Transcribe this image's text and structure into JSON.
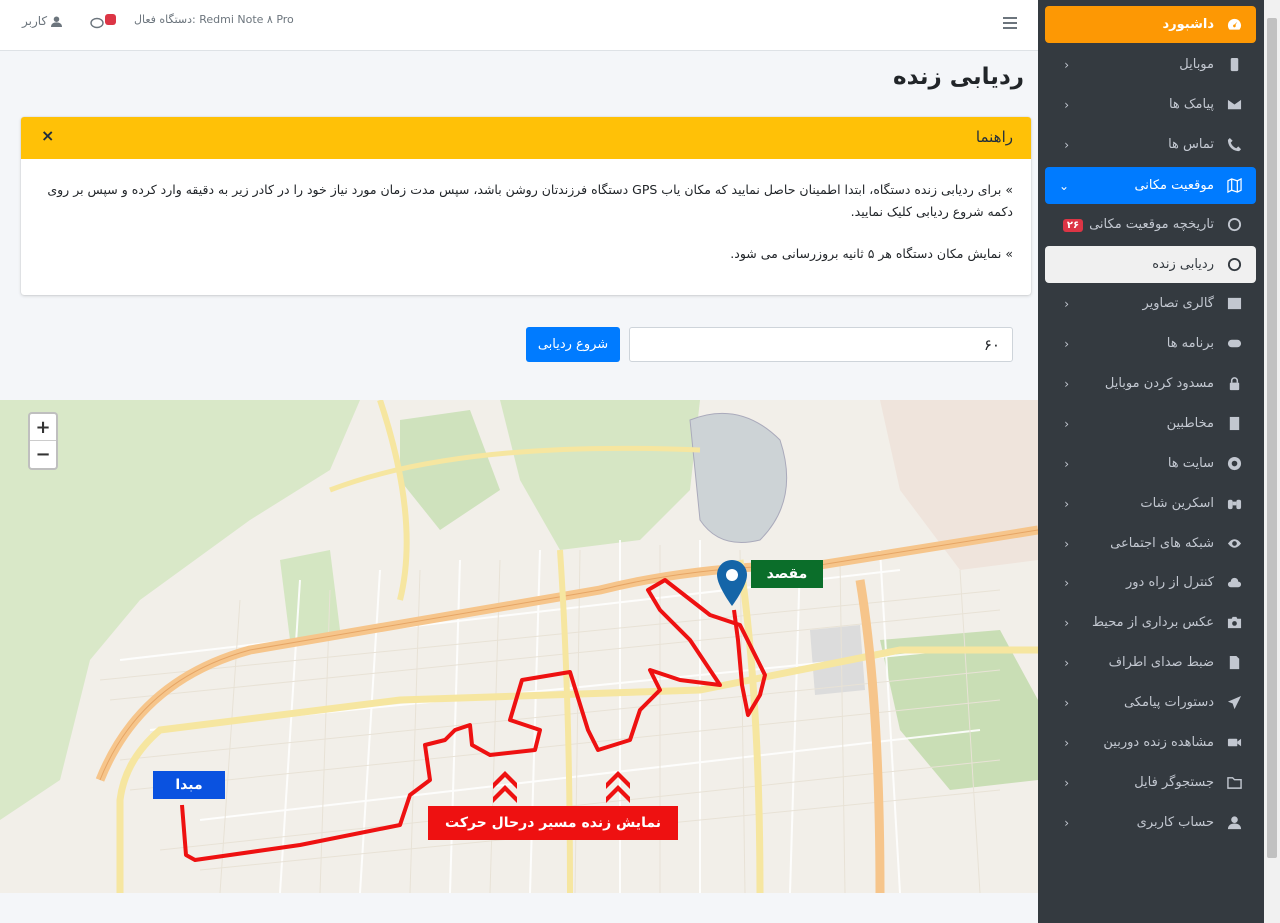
{
  "navbar": {
    "user_label": "کاربر",
    "device_label": "دستگاه فعال: Redmi Note ۸ Pro"
  },
  "sidebar": {
    "items": [
      {
        "label": "داشبورد",
        "icon": "dashboard-icon"
      },
      {
        "label": "موبایل",
        "icon": "mobile-icon"
      },
      {
        "label": "پیامک ها",
        "icon": "envelope-icon"
      },
      {
        "label": "تماس ها",
        "icon": "phone-icon"
      },
      {
        "label": "موقعیت مکانی",
        "icon": "map-icon"
      },
      {
        "label": "تاریخچه موقعیت مکانی",
        "icon": "circle-icon",
        "badge": "۲۶"
      },
      {
        "label": "ردیابی زنده",
        "icon": "circle-icon"
      },
      {
        "label": "گالری تصاویر",
        "icon": "image-icon"
      },
      {
        "label": "برنامه ها",
        "icon": "gamepad-icon"
      },
      {
        "label": "مسدود کردن موبایل",
        "icon": "lock-icon"
      },
      {
        "label": "مخاطبین",
        "icon": "book-icon"
      },
      {
        "label": "سایت ها",
        "icon": "chrome-icon"
      },
      {
        "label": "اسکرین شات",
        "icon": "binoculars-icon"
      },
      {
        "label": "شبکه های اجتماعی",
        "icon": "eye-icon"
      },
      {
        "label": "کنترل از راه دور",
        "icon": "cloud-icon"
      },
      {
        "label": "عکس برداری از محیط",
        "icon": "camera-icon"
      },
      {
        "label": "ضبط صدای اطراف",
        "icon": "audio-file-icon"
      },
      {
        "label": "دستورات پیامکی",
        "icon": "paper-plane-icon"
      },
      {
        "label": "مشاهده زنده دوربین",
        "icon": "video-icon"
      },
      {
        "label": "جستجوگر فایل",
        "icon": "folder-icon"
      },
      {
        "label": "حساب کاربری",
        "icon": "user-icon"
      }
    ]
  },
  "page": {
    "title": "ردیابی زنده"
  },
  "guide": {
    "title": "راهنما",
    "close": "×",
    "line1": "» برای ردیابی زنده دستگاه، ابتدا اطمینان حاصل نمایید که مکان یاب GPS دستگاه فرزندتان روشن باشد، سپس مدت زمان مورد نیاز خود را در کادر زیر به دقیقه وارد کرده و سپس بر روی دکمه شروع ردیابی کلیک نمایید.",
    "line2": "» نمایش مکان دستگاه هر ۵ ثانیه بروزرسانی می شود."
  },
  "tracking": {
    "duration_value": "۶۰",
    "start_button": "شروع ردیابی"
  },
  "map": {
    "zoom_in": "+",
    "zoom_out": "−",
    "destination_label": "مقصد",
    "origin_label": "مبدا",
    "live_label": "نمایش زنده مسیر درحال حرکت"
  },
  "colors": {
    "sidebar_bg": "#343a40",
    "active_dashboard": "#fd9804",
    "active_section": "#007bff",
    "guide_header": "#ffc107",
    "route": "#ee1111",
    "destination": "#0b6e2a",
    "origin": "#0a52e0"
  }
}
